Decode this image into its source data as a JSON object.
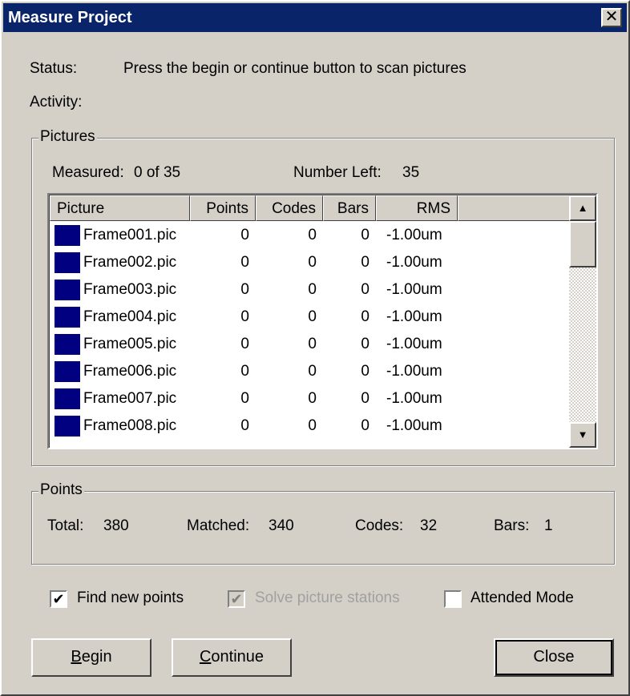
{
  "window": {
    "title": "Measure Project",
    "close_glyph": "✕"
  },
  "status": {
    "label": "Status:",
    "value": "Press the begin or continue button to scan pictures"
  },
  "activity": {
    "label": "Activity:",
    "value": ""
  },
  "pictures": {
    "group_label": "Pictures",
    "measured_label": "Measured:",
    "measured_value": "0 of 35",
    "left_label": "Number Left:",
    "left_value": "35",
    "columns": [
      "Picture",
      "Points",
      "Codes",
      "Bars",
      "RMS"
    ],
    "rows": [
      {
        "name": "Frame001.pic",
        "points": "0",
        "codes": "0",
        "bars": "0",
        "rms": "-1.00um",
        "color": "#000080"
      },
      {
        "name": "Frame002.pic",
        "points": "0",
        "codes": "0",
        "bars": "0",
        "rms": "-1.00um",
        "color": "#000080"
      },
      {
        "name": "Frame003.pic",
        "points": "0",
        "codes": "0",
        "bars": "0",
        "rms": "-1.00um",
        "color": "#000080"
      },
      {
        "name": "Frame004.pic",
        "points": "0",
        "codes": "0",
        "bars": "0",
        "rms": "-1.00um",
        "color": "#000080"
      },
      {
        "name": "Frame005.pic",
        "points": "0",
        "codes": "0",
        "bars": "0",
        "rms": "-1.00um",
        "color": "#000080"
      },
      {
        "name": "Frame006.pic",
        "points": "0",
        "codes": "0",
        "bars": "0",
        "rms": "-1.00um",
        "color": "#000080"
      },
      {
        "name": "Frame007.pic",
        "points": "0",
        "codes": "0",
        "bars": "0",
        "rms": "-1.00um",
        "color": "#000080"
      },
      {
        "name": "Frame008.pic",
        "points": "0",
        "codes": "0",
        "bars": "0",
        "rms": "-1.00um",
        "color": "#000080"
      }
    ],
    "scroll_up_glyph": "▲",
    "scroll_down_glyph": "▼"
  },
  "points": {
    "group_label": "Points",
    "total_label": "Total:",
    "total_value": "380",
    "matched_label": "Matched:",
    "matched_value": "340",
    "codes_label": "Codes:",
    "codes_value": "32",
    "bars_label": "Bars:",
    "bars_value": "1"
  },
  "options": {
    "find_new_points": {
      "label": "Find new points",
      "checked": true,
      "enabled": true
    },
    "solve_picture_stations": {
      "label": "Solve picture stations",
      "checked": true,
      "enabled": false
    },
    "attended_mode": {
      "label": "Attended Mode",
      "checked": false,
      "enabled": true
    },
    "check_glyph": "✔"
  },
  "buttons": {
    "begin": {
      "mnemonic": "B",
      "rest": "egin"
    },
    "continue": {
      "mnemonic": "C",
      "rest": "ontinue"
    },
    "close": "Close"
  },
  "colors": {
    "titlebar": "#0a246a",
    "dialog_bg": "#d4d0c8",
    "swatch": "#000080"
  }
}
